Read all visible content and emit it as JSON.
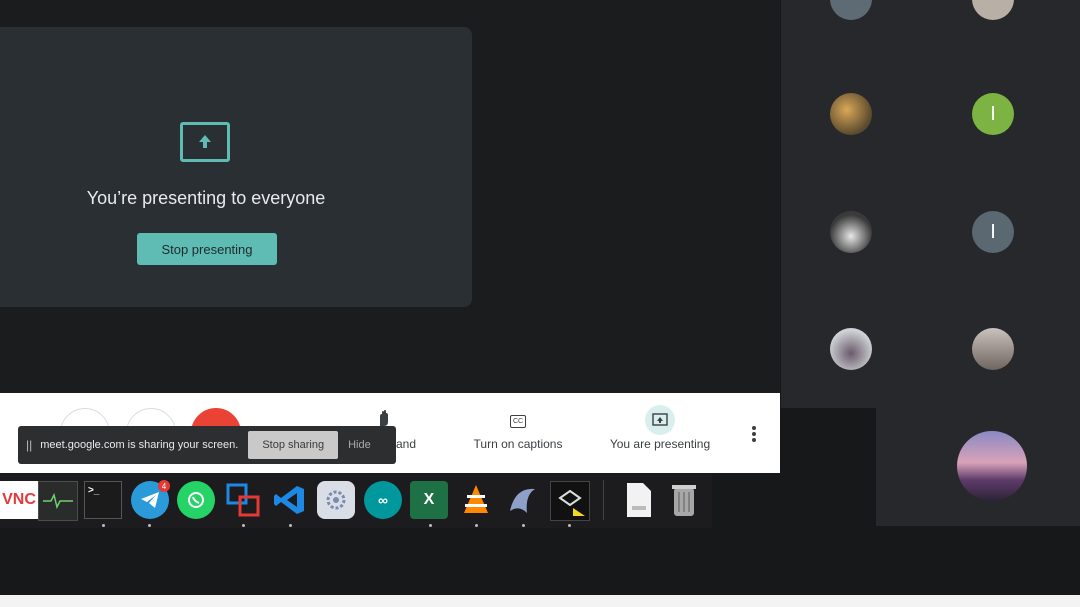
{
  "presentation": {
    "title": "You’re presenting to everyone",
    "stop_label": "Stop presenting",
    "icon": "present-to-all-icon"
  },
  "participants": [
    {
      "name": "participant-1",
      "initial": ""
    },
    {
      "name": "participant-2",
      "initial": ""
    },
    {
      "name": "participant-3",
      "initial": ""
    },
    {
      "name": "participant-4",
      "initial": "I"
    },
    {
      "name": "participant-5",
      "initial": ""
    },
    {
      "name": "participant-6",
      "initial": "I"
    },
    {
      "name": "participant-7",
      "initial": ""
    },
    {
      "name": "participant-8",
      "initial": ""
    },
    {
      "name": "participant-9",
      "initial": ""
    }
  ],
  "toolbar": {
    "raise_hand_label": "and",
    "captions_label": "Turn on captions",
    "presenting_label": "You are presenting",
    "captions_icon_text": "CC"
  },
  "share_notice": {
    "message": "meet.google.com is sharing your screen.",
    "stop_label": "Stop sharing",
    "hide_label": "Hide"
  },
  "dock": {
    "apps": [
      "vnc-viewer",
      "system-monitor",
      "terminal",
      "telegram",
      "whatsapp",
      "virtualbox",
      "vscode",
      "settings",
      "arduino",
      "excel",
      "vlc",
      "mysql-workbench",
      "inkscape",
      "document",
      "trash"
    ],
    "telegram_badge": "4"
  },
  "colors": {
    "accent": "#5fbcb4",
    "stage": "#1b1c1e",
    "panel": "#27282b",
    "card": "#2a2f33",
    "end_call": "#ea4335"
  }
}
